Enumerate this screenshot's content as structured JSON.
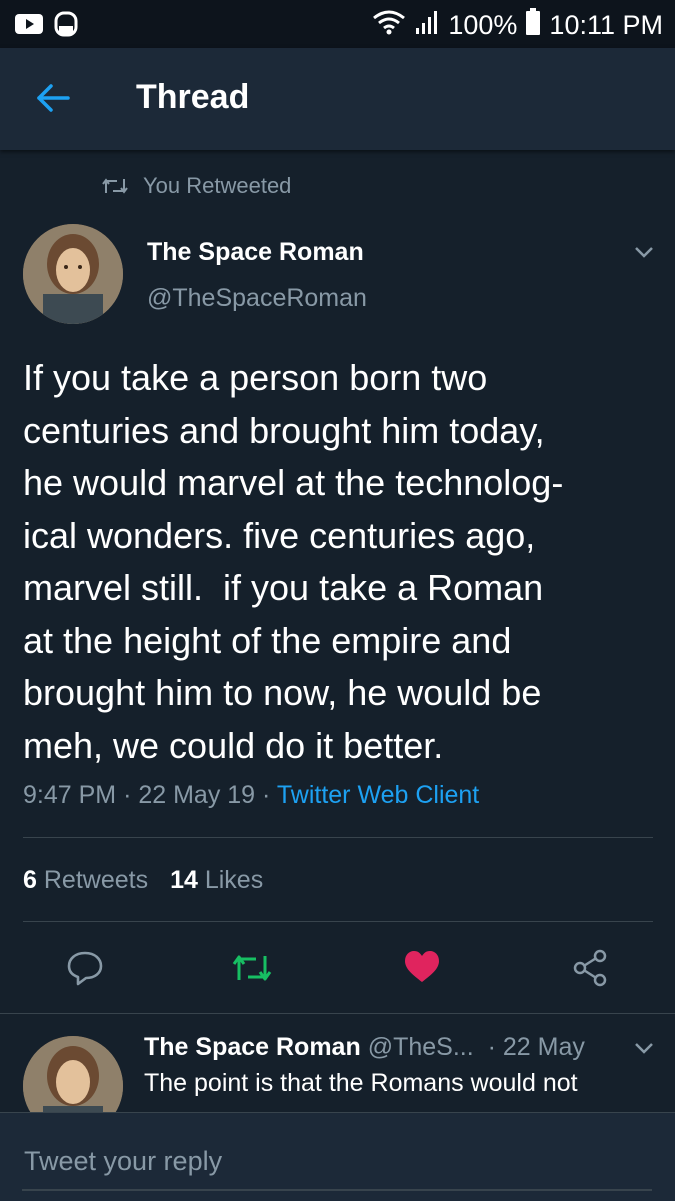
{
  "status_bar": {
    "battery_percent": "100%",
    "time": "10:11 PM",
    "icons": [
      "youtube-icon",
      "android-face-icon",
      "wifi-icon",
      "signal-icon",
      "battery-icon"
    ]
  },
  "header": {
    "title": "Thread"
  },
  "retweet_banner": {
    "text": "You Retweeted"
  },
  "tweet": {
    "author_name": "The Space Roman",
    "author_handle": "@TheSpaceRoman",
    "body": "If you take a person born two\ncenturies and brought him today,\nhe would marvel at the technolog-\nical wonders. five centuries ago,\nmarvel still.  if you take a Roman\nat the height of the empire and\nbrought him to now, he would be\nmeh, we could do it better.",
    "time": "9:47 PM",
    "date": "22 May 19",
    "client": "Twitter Web Client",
    "retweets_count": "6",
    "retweets_label": "Retweets",
    "likes_count": "14",
    "likes_label": "Likes"
  },
  "reply": {
    "author_name": "The Space Roman",
    "author_handle": "@TheS...",
    "date": "22 May",
    "text": "The point is that the Romans would not"
  },
  "compose": {
    "placeholder": "Tweet your reply"
  },
  "colors": {
    "background": "#15202b",
    "appbar": "#1c2938",
    "accent": "#1da1f2",
    "retweet_green": "#17bf63",
    "like_red": "#e0245e",
    "secondary_text": "#8899a6"
  }
}
